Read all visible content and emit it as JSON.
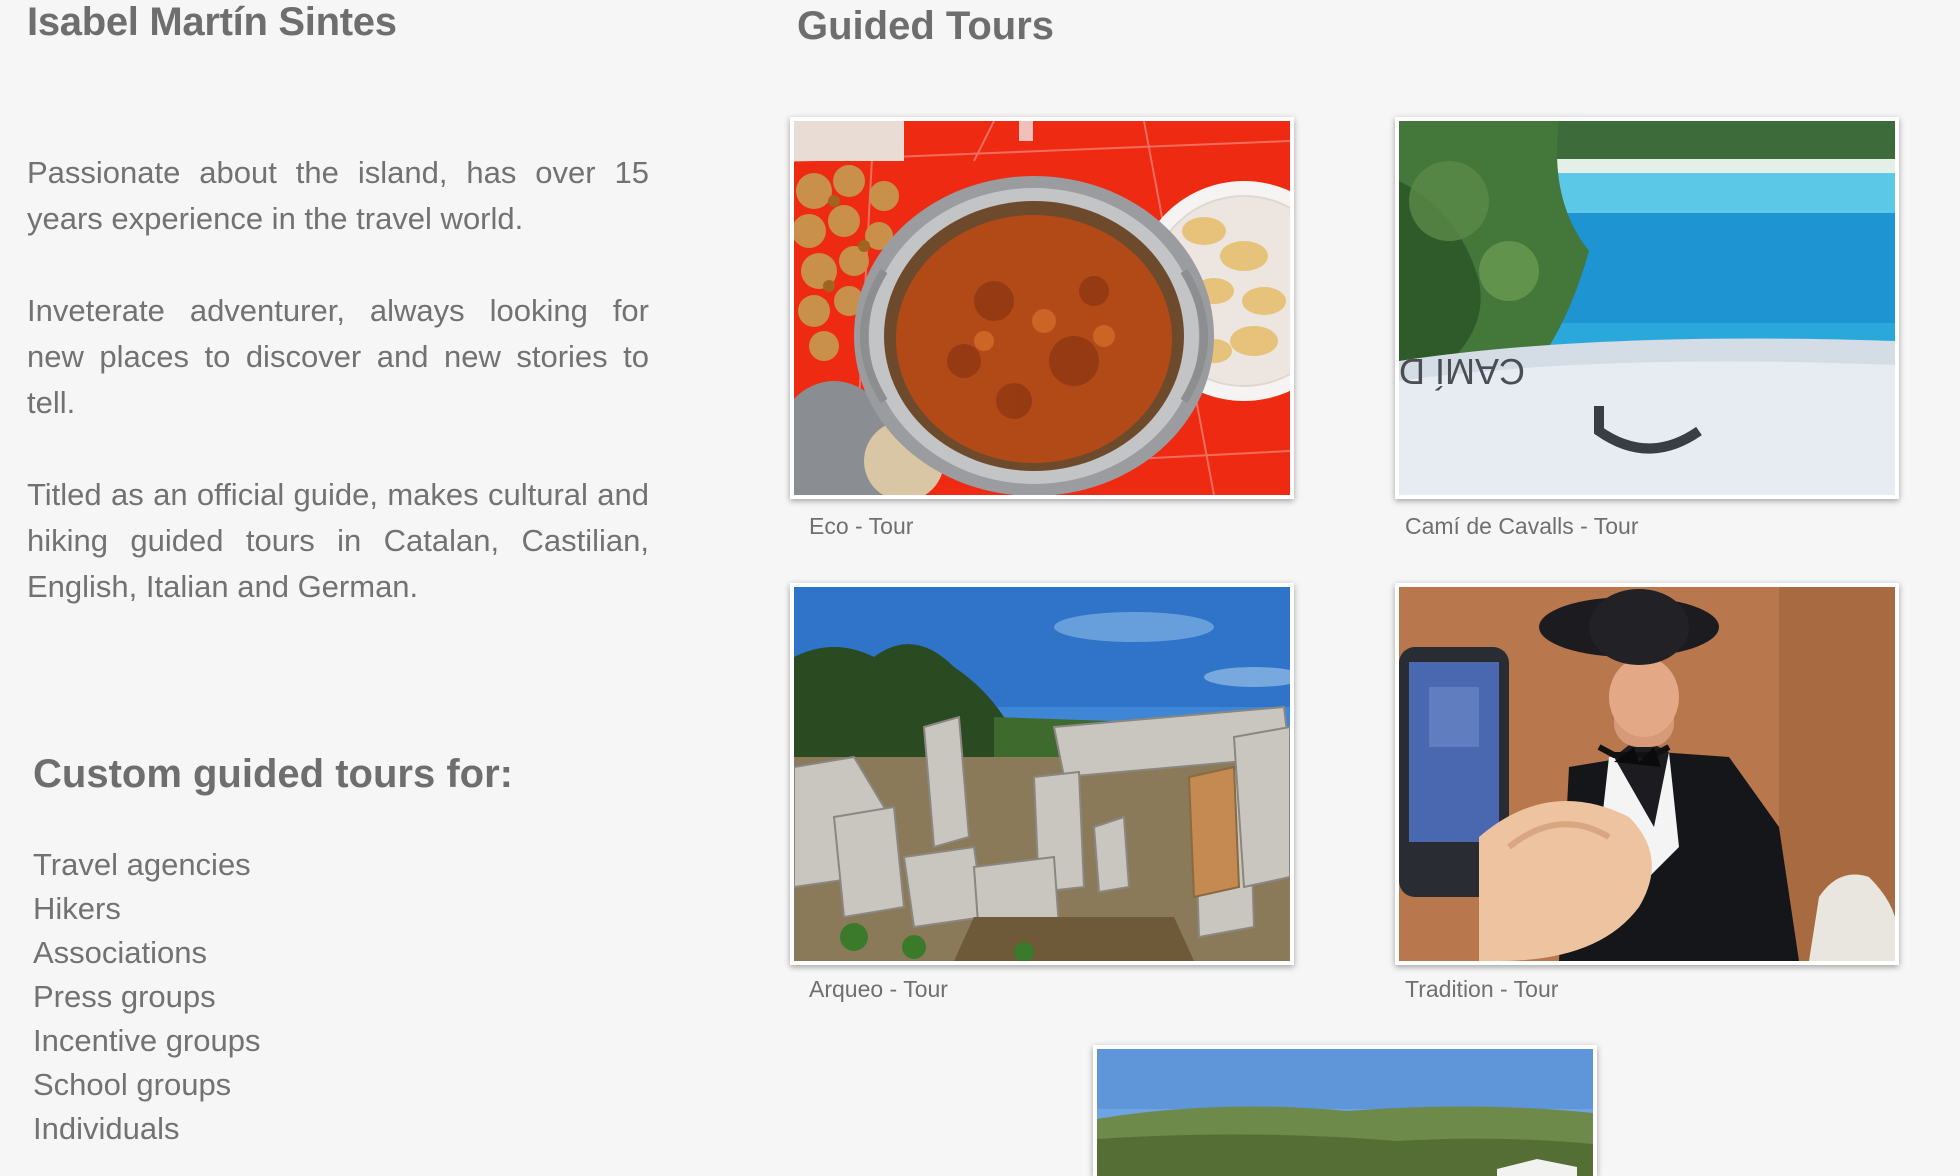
{
  "profile": {
    "name": "Isabel Martín Sintes",
    "bio": [
      "Passionate about the island, has over 15 years experience in the travel world.",
      "Inveterate adventurer, always looking for new places to discover and new  stories to tell.",
      "Titled as an official guide, makes cultural and hiking guided tours in Catalan, Castilian, English, Italian and German."
    ]
  },
  "custom": {
    "heading": "Custom guided tours for:",
    "items": [
      "Travel agencies",
      "Hikers",
      "Associations",
      "Press groups",
      "Incentive groups",
      "School groups",
      "Individuals"
    ]
  },
  "tours": {
    "heading": "Guided Tours",
    "items": [
      {
        "label": "Eco - Tour"
      },
      {
        "label": "Camí de Cavalls - Tour",
        "sign_text": "CAMÍ DE CAVA"
      },
      {
        "label": "Arqueo - Tour"
      },
      {
        "label": "Tradition - Tour"
      },
      {
        "label": ""
      }
    ]
  },
  "colors": {
    "background": "#f7f6f6",
    "text": "#727272",
    "heading": "#6e6e6e"
  }
}
